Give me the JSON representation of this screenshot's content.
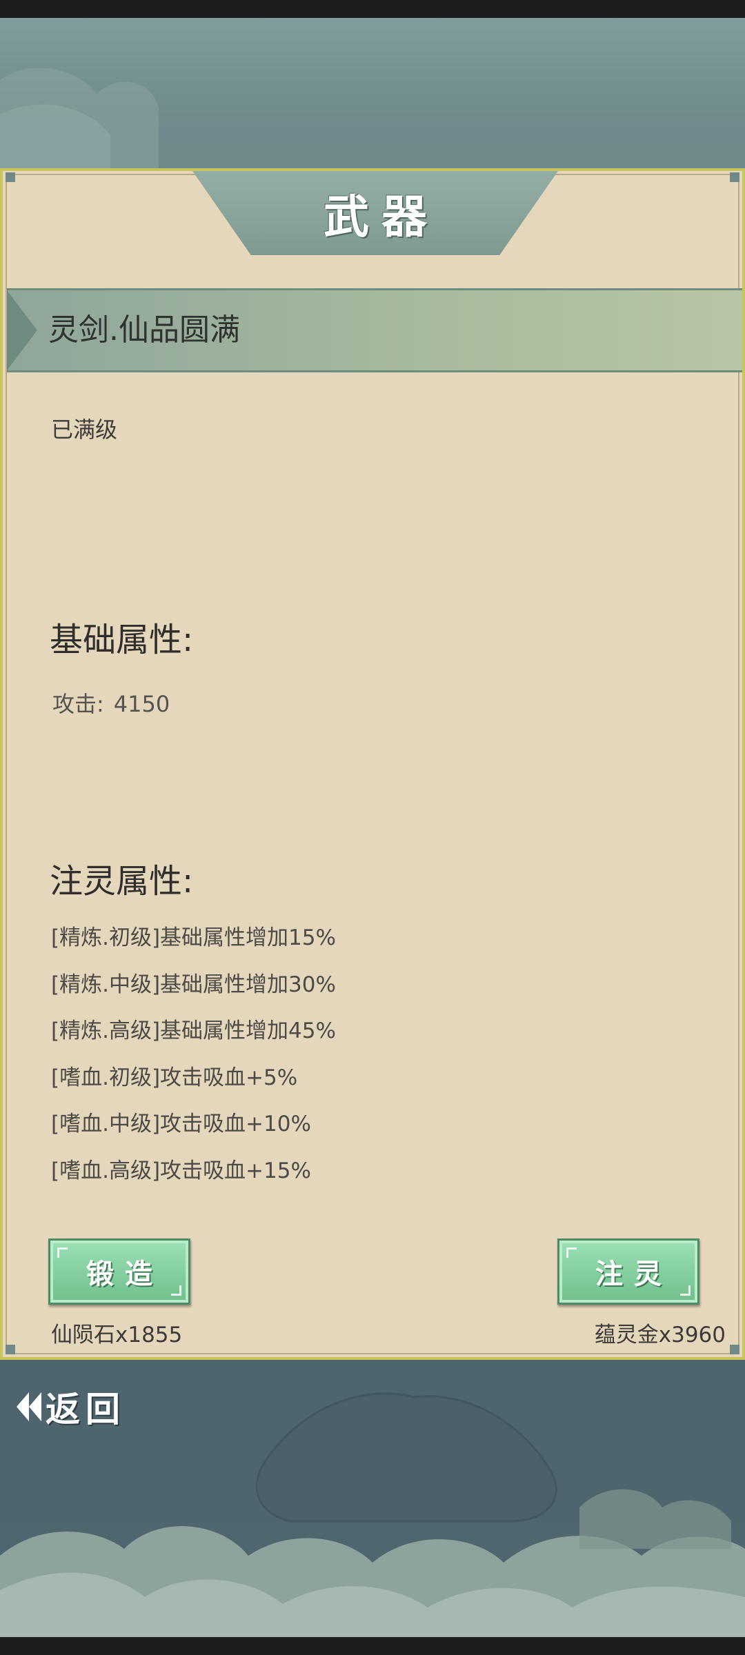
{
  "header": {
    "title": "武器"
  },
  "weapon": {
    "name": "灵剑.仙品圆满",
    "level_status": "已满级"
  },
  "base_attributes": {
    "heading": "基础属性:",
    "attack_label": "攻击:",
    "attack_value": "4150"
  },
  "infuse_attributes": {
    "heading": "注灵属性:",
    "items": [
      "[精炼.初级]基础属性增加15%",
      "[精炼.中级]基础属性增加30%",
      "[精炼.高级]基础属性增加45%",
      "[嗜血.初级]攻击吸血+5%",
      "[嗜血.中级]攻击吸血+10%",
      "[嗜血.高级]攻击吸血+15%"
    ]
  },
  "actions": {
    "forge_label": "锻造",
    "forge_cost": "仙陨石x1855",
    "infuse_label": "注灵",
    "infuse_cost": "蕴灵金x3960"
  },
  "footer": {
    "back_label": "返回",
    "back_icon": "double-chevron-left-icon"
  },
  "colors": {
    "panel_bg": "#e5d7bb",
    "panel_border": "#c8c35a",
    "banner": "#a8bb9e",
    "button_green": "#7fcf9c",
    "sky": "#5a7377"
  }
}
